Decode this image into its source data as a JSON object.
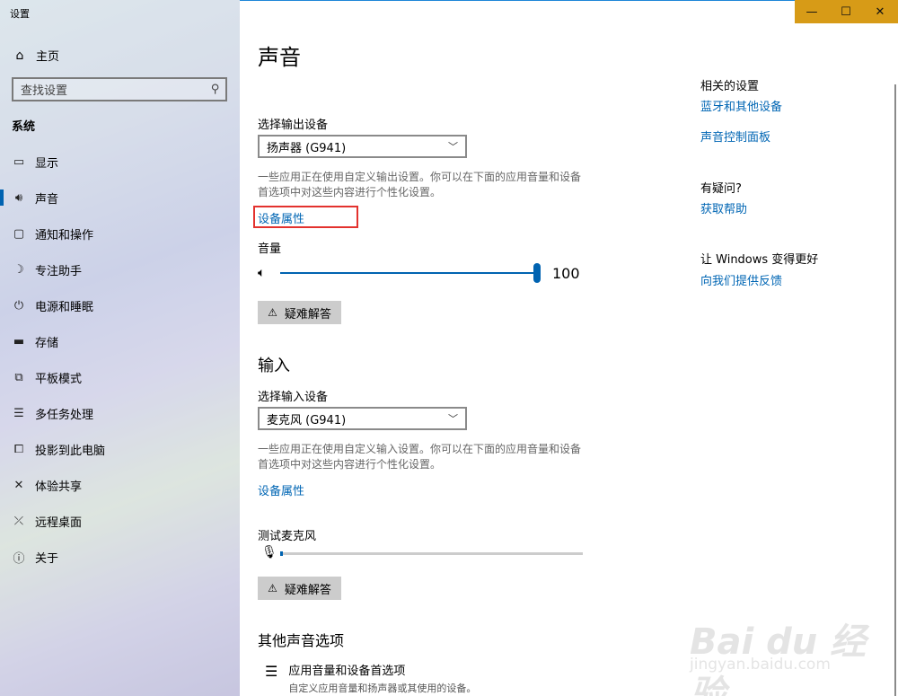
{
  "window": {
    "title": "设置",
    "controls": [
      "—",
      "☐",
      "✕"
    ]
  },
  "sidebar": {
    "home_label": "主页",
    "search_placeholder": "查找设置",
    "section_label": "系统",
    "items": [
      {
        "label": "显示",
        "icon": "display-icon"
      },
      {
        "label": "声音",
        "icon": "speaker-icon",
        "active": true
      },
      {
        "label": "通知和操作",
        "icon": "notification-icon"
      },
      {
        "label": "专注助手",
        "icon": "moon-icon"
      },
      {
        "label": "电源和睡眠",
        "icon": "power-icon"
      },
      {
        "label": "存储",
        "icon": "storage-icon"
      },
      {
        "label": "平板模式",
        "icon": "tablet-icon"
      },
      {
        "label": "多任务处理",
        "icon": "multitask-icon"
      },
      {
        "label": "投影到此电脑",
        "icon": "project-icon"
      },
      {
        "label": "体验共享",
        "icon": "share-icon"
      },
      {
        "label": "远程桌面",
        "icon": "remote-icon"
      },
      {
        "label": "关于",
        "icon": "info-icon"
      }
    ]
  },
  "main": {
    "title": "声音",
    "output": {
      "label": "选择输出设备",
      "selected": "扬声器 (G941)",
      "desc": "一些应用正在使用自定义输出设置。你可以在下面的应用音量和设备首选项中对这些内容进行个性化设置。",
      "props_link": "设备属性",
      "volume_label": "音量",
      "volume_value": "100",
      "troubleshoot": "疑难解答"
    },
    "input": {
      "heading": "输入",
      "label": "选择输入设备",
      "selected": "麦克风 (G941)",
      "desc": "一些应用正在使用自定义输入设置。你可以在下面的应用音量和设备首选项中对这些内容进行个性化设置。",
      "props_link": "设备属性",
      "test_label": "测试麦克风",
      "troubleshoot": "疑难解答"
    },
    "other": {
      "heading": "其他声音选项",
      "app_volume_title": "应用音量和设备首选项",
      "app_volume_desc": "自定义应用音量和扬声器或其使用的设备。"
    }
  },
  "right": {
    "related_heading": "相关的设置",
    "related_links": [
      "蓝牙和其他设备",
      "声音控制面板"
    ],
    "question_heading": "有疑问?",
    "help_link": "获取帮助",
    "improve_heading": "让 Windows 变得更好",
    "feedback_link": "向我们提供反馈"
  },
  "watermark": {
    "line1": "Bai du 经验",
    "line2": "jingyan.baidu.com"
  }
}
